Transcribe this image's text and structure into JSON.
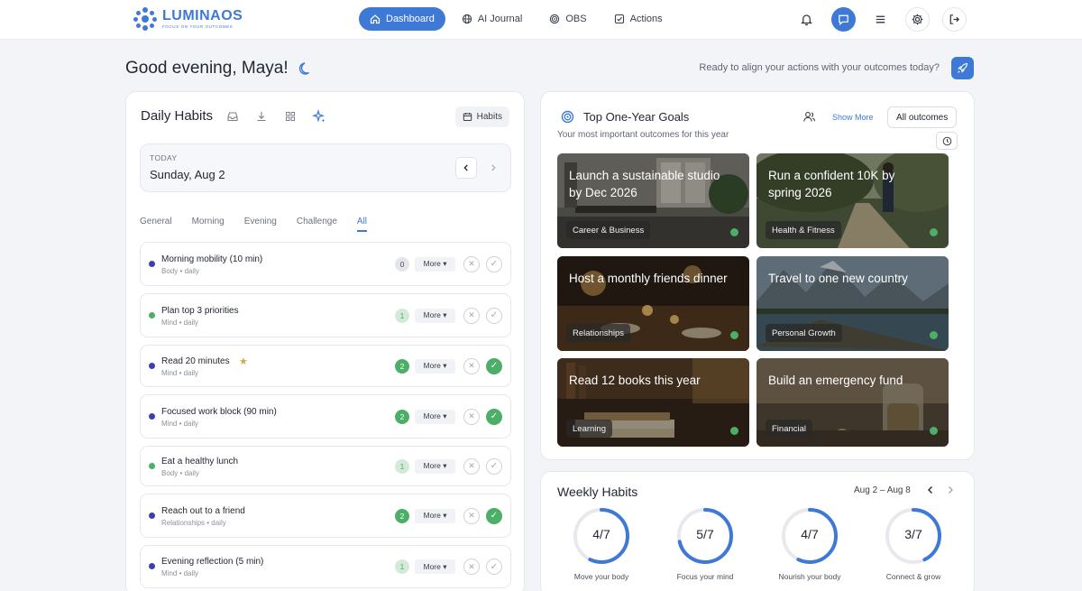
{
  "brand": {
    "name": "LUMINAOS",
    "tagline": "FOCUS ON YOUR OUTCOMES",
    "accent": "#3f79d6"
  },
  "nav": [
    {
      "label": "Dashboard",
      "icon": "home-icon",
      "active": true
    },
    {
      "label": "AI Journal",
      "icon": "globe-icon",
      "active": false
    },
    {
      "label": "OBS",
      "icon": "target-icon",
      "active": false
    },
    {
      "label": "Actions",
      "icon": "checkbox-icon",
      "active": false
    }
  ],
  "header_icons": [
    "bell-icon",
    "chat-icon",
    "menu-icon",
    "settings-icon",
    "logout-icon"
  ],
  "greeting": {
    "text": "Good evening, Maya!",
    "prompt": "Ready to align your actions with your outcomes today?"
  },
  "daily": {
    "title": "Daily Habits",
    "habits_button": "Habits",
    "date_label": "TODAY",
    "date_value": "Sunday, Aug 2",
    "tabs": [
      "General",
      "Morning",
      "Evening",
      "Challenge",
      "All"
    ],
    "active_tab": "All",
    "more_label": "More ▾",
    "items": [
      {
        "title": "Morning mobility (10 min)",
        "sub": "Body • daily",
        "count": "0",
        "dot": "#3b3fb0",
        "done": false,
        "star": false
      },
      {
        "title": "Plan top 3 priorities",
        "sub": "Mind • daily",
        "count": "1",
        "dot": "#4caf67",
        "done": false,
        "star": false
      },
      {
        "title": "Read 20 minutes",
        "sub": "Mind • daily",
        "count": "2",
        "dot": "#3b3fb0",
        "done": true,
        "star": true
      },
      {
        "title": "Focused work block (90 min)",
        "sub": "Mind • daily",
        "count": "2",
        "dot": "#3b3fb0",
        "done": true,
        "star": false
      },
      {
        "title": "Eat a healthy lunch",
        "sub": "Body • daily",
        "count": "1",
        "dot": "#4caf67",
        "done": false,
        "star": false
      },
      {
        "title": "Reach out to a friend",
        "sub": "Relationships • daily",
        "count": "2",
        "dot": "#3b3fb0",
        "done": true,
        "star": false
      },
      {
        "title": "Evening reflection (5 min)",
        "sub": "Mind • daily",
        "count": "1",
        "dot": "#3b3fb0",
        "done": false,
        "star": false
      }
    ]
  },
  "goals": {
    "title": "Top One-Year Goals",
    "subtitle": "Your most important outcomes for this year",
    "show_more": "Show More",
    "filter": "All outcomes",
    "items": [
      {
        "title": "Launch a sustainable studio by Dec 2026",
        "tag": "Career & Business",
        "scene": "studio"
      },
      {
        "title": "Run a confident 10K by spring 2026",
        "tag": "Health & Fitness",
        "scene": "run"
      },
      {
        "title": "Host a monthly friends dinner",
        "tag": "Relationships",
        "scene": "dinner"
      },
      {
        "title": "Travel to one new country",
        "tag": "Personal Growth",
        "scene": "lake"
      },
      {
        "title": "Read 12 books this year",
        "tag": "Learning",
        "scene": "books"
      },
      {
        "title": "Build an emergency fund",
        "tag": "Financial",
        "scene": "jar"
      }
    ]
  },
  "weekly": {
    "title": "Weekly Habits",
    "range": "Aug 2 – Aug 8",
    "rings": [
      {
        "value": "4/7",
        "fraction": 0.571,
        "label": "Move your body"
      },
      {
        "value": "5/7",
        "fraction": 0.714,
        "label": "Focus your mind"
      },
      {
        "value": "4/7",
        "fraction": 0.571,
        "label": "Nourish your body"
      },
      {
        "value": "3/7",
        "fraction": 0.429,
        "label": "Connect & grow"
      }
    ]
  }
}
